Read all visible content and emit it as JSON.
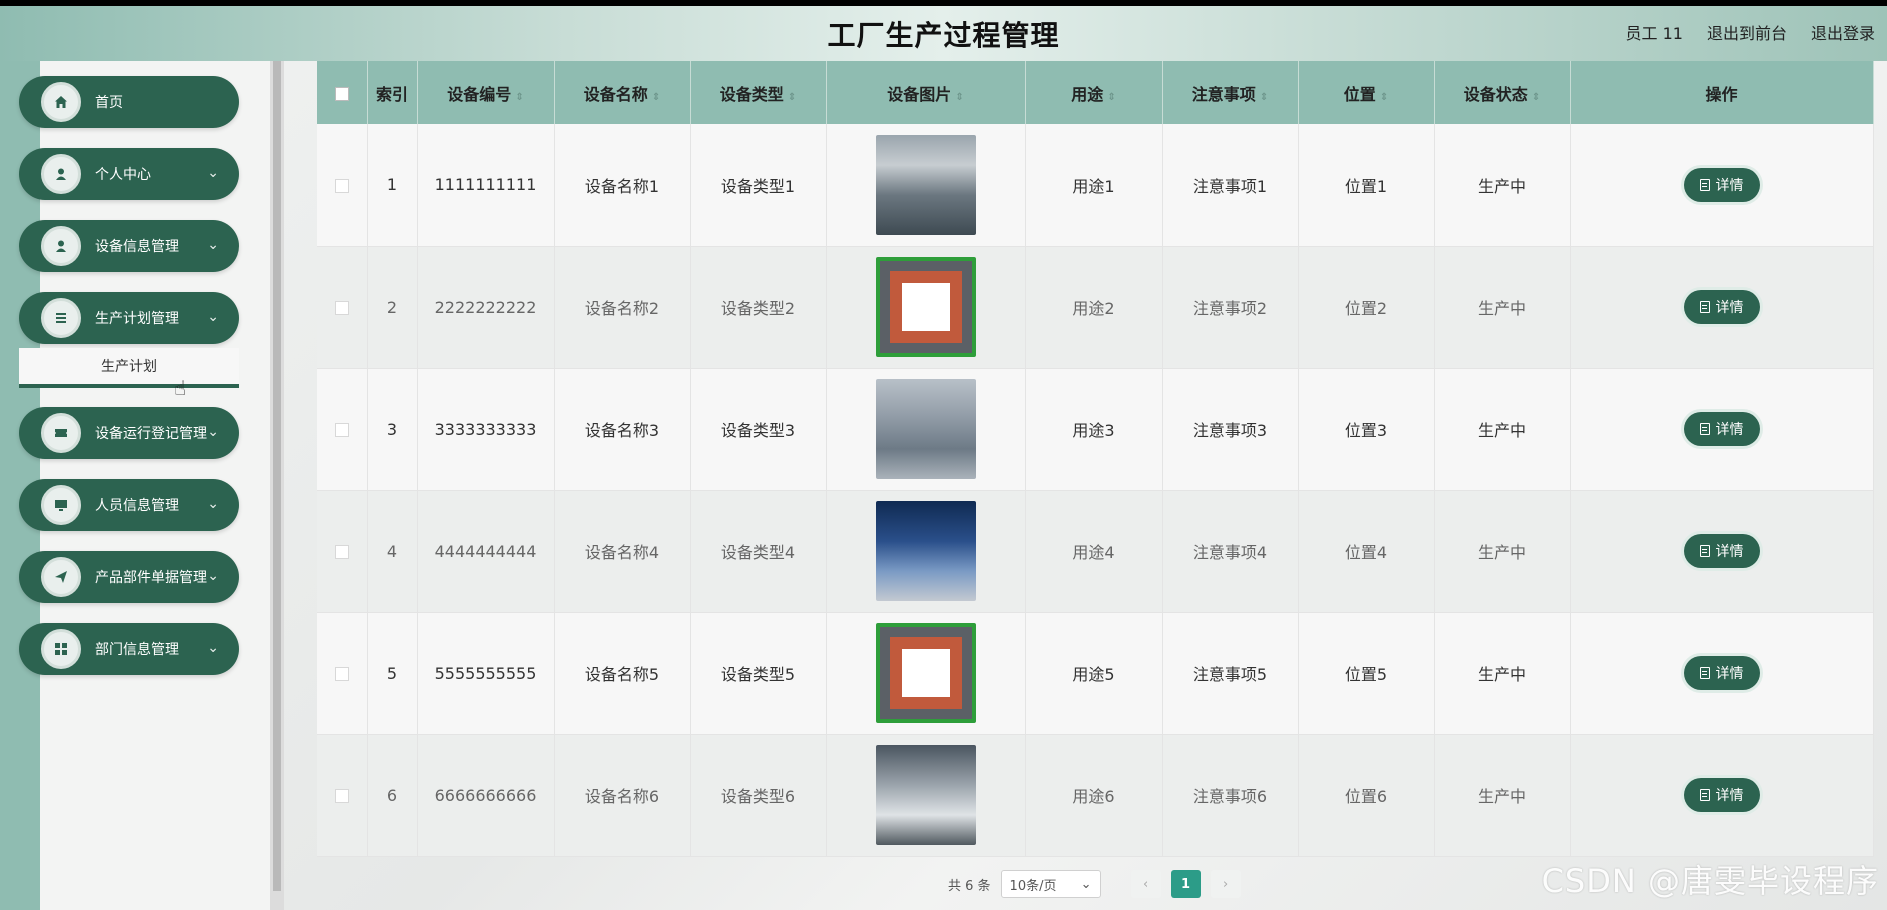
{
  "header": {
    "title": "工厂生产过程管理",
    "user": "员工 11",
    "to_front": "退出到前台",
    "logout": "退出登录"
  },
  "sidebar": {
    "items": [
      {
        "label": "首页",
        "icon": "home-icon",
        "has_children": false
      },
      {
        "label": "个人中心",
        "icon": "user-icon",
        "has_children": true
      },
      {
        "label": "设备信息管理",
        "icon": "user-icon",
        "has_children": true
      },
      {
        "label": "生产计划管理",
        "icon": "list-icon",
        "has_children": true
      },
      {
        "label": "设备运行登记管理",
        "icon": "ticket-icon",
        "has_children": true
      },
      {
        "label": "人员信息管理",
        "icon": "monitor-icon",
        "has_children": true
      },
      {
        "label": "产品部件单据管理",
        "icon": "send-icon",
        "has_children": true
      },
      {
        "label": "部门信息管理",
        "icon": "grid-icon",
        "has_children": true
      }
    ],
    "submenu_label": "生产计划"
  },
  "table": {
    "headers": [
      "索引",
      "设备编号",
      "设备名称",
      "设备类型",
      "设备图片",
      "用途",
      "注意事项",
      "位置",
      "设备状态",
      "操作"
    ],
    "rows": [
      {
        "index": "1",
        "code": "1111111111",
        "name": "设备名称1",
        "type": "设备类型1",
        "use": "用途1",
        "notes": "注意事项1",
        "location": "位置1",
        "status": "生产中",
        "action": "详情"
      },
      {
        "index": "2",
        "code": "2222222222",
        "name": "设备名称2",
        "type": "设备类型2",
        "use": "用途2",
        "notes": "注意事项2",
        "location": "位置2",
        "status": "生产中",
        "action": "详情"
      },
      {
        "index": "3",
        "code": "3333333333",
        "name": "设备名称3",
        "type": "设备类型3",
        "use": "用途3",
        "notes": "注意事项3",
        "location": "位置3",
        "status": "生产中",
        "action": "详情"
      },
      {
        "index": "4",
        "code": "4444444444",
        "name": "设备名称4",
        "type": "设备类型4",
        "use": "用途4",
        "notes": "注意事项4",
        "location": "位置4",
        "status": "生产中",
        "action": "详情"
      },
      {
        "index": "5",
        "code": "5555555555",
        "name": "设备名称5",
        "type": "设备类型5",
        "use": "用途5",
        "notes": "注意事项5",
        "location": "位置5",
        "status": "生产中",
        "action": "详情"
      },
      {
        "index": "6",
        "code": "6666666666",
        "name": "设备名称6",
        "type": "设备类型6",
        "use": "用途6",
        "notes": "注意事项6",
        "location": "位置6",
        "status": "生产中",
        "action": "详情"
      }
    ]
  },
  "pagination": {
    "total": "共 6 条",
    "page_size": "10条/页",
    "current_page": "1"
  },
  "watermark": "CSDN @唐雯毕设程序",
  "colors": {
    "accent": "#2c6350",
    "header_bg": "#8fbcb1",
    "pager_active": "#2c9c88"
  }
}
